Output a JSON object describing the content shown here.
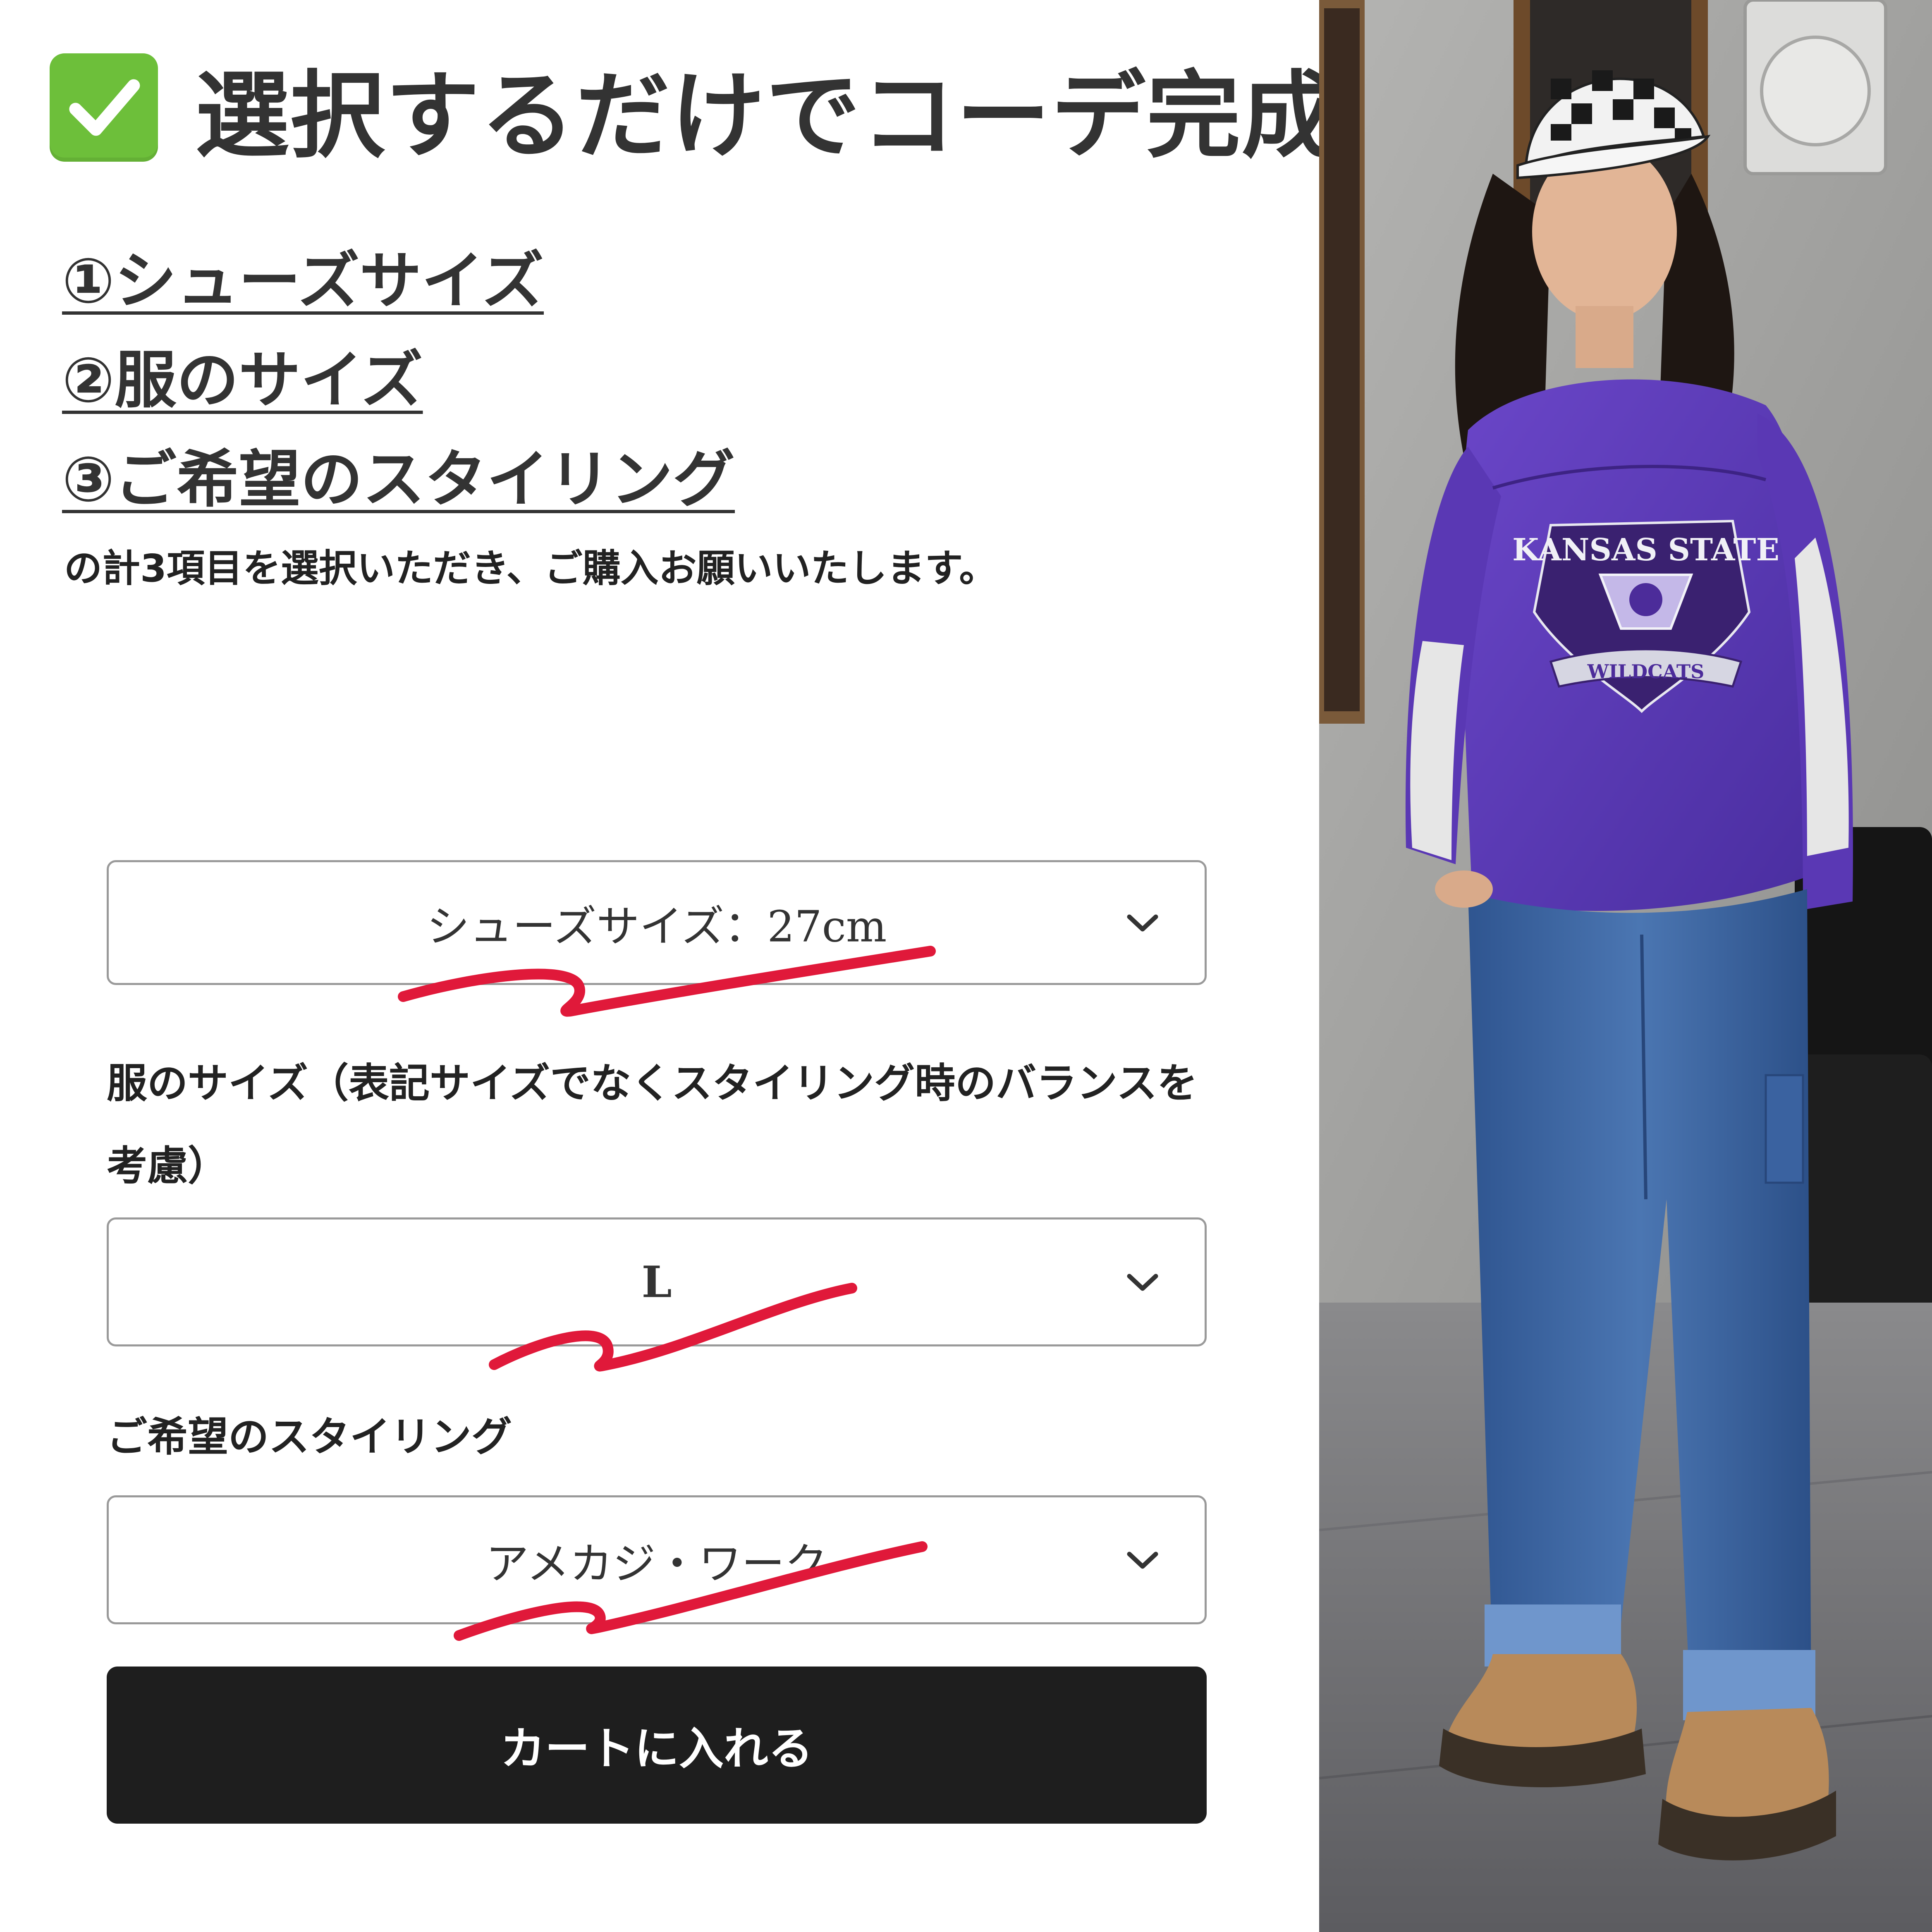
{
  "headline": "選択するだけでコーデ完成！",
  "steps": [
    "①シューズサイズ",
    "②服のサイズ",
    "③ご希望のスタイリング"
  ],
  "note": "の計3項目を選択いただき、ご購入お願いいたします。",
  "form": {
    "shoe_size_value": "シューズサイズ：27cm",
    "clothing_size_label": "服のサイズ（表記サイズでなくスタイリング時のバランスを考慮）",
    "clothing_size_label_line1": "服のサイズ（表記サイズでなくスタイリング時のバランスを",
    "clothing_size_label_line2": "考慮）",
    "clothing_size_value": "L",
    "styling_label": "ご希望のスタイリング",
    "styling_value": "アメカジ・ワーク",
    "cart_button": "カートに入れる"
  },
  "photo": {
    "sweatshirt_text_top": "KANSAS STATE",
    "sweatshirt_text_banner": "WILDCATS"
  },
  "colors": {
    "accent_check": "#6dbf3a",
    "annotation_red": "#e0193a",
    "button_bg": "#1e1e1e",
    "sweatshirt": "#5a38b4",
    "jeans": "#3f68a4"
  }
}
